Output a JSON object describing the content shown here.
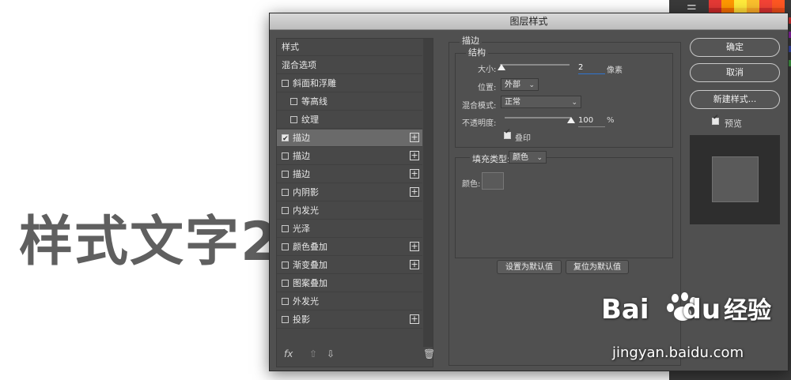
{
  "canvas_text": "样式文字2",
  "dialog": {
    "title": "图层样式",
    "style_list": [
      {
        "label": "样式",
        "checkbox": false,
        "checked": false,
        "plus": false,
        "indent": 0,
        "selected": false
      },
      {
        "label": "混合选项",
        "checkbox": false,
        "checked": false,
        "plus": false,
        "indent": 0,
        "selected": false
      },
      {
        "label": "斜面和浮雕",
        "checkbox": true,
        "checked": false,
        "plus": false,
        "indent": 0,
        "selected": false
      },
      {
        "label": "等高线",
        "checkbox": true,
        "checked": false,
        "plus": false,
        "indent": 1,
        "selected": false
      },
      {
        "label": "纹理",
        "checkbox": true,
        "checked": false,
        "plus": false,
        "indent": 1,
        "selected": false
      },
      {
        "label": "描边",
        "checkbox": true,
        "checked": true,
        "plus": true,
        "indent": 0,
        "selected": true
      },
      {
        "label": "描边",
        "checkbox": true,
        "checked": false,
        "plus": true,
        "indent": 0,
        "selected": false
      },
      {
        "label": "描边",
        "checkbox": true,
        "checked": false,
        "plus": true,
        "indent": 0,
        "selected": false
      },
      {
        "label": "内阴影",
        "checkbox": true,
        "checked": false,
        "plus": true,
        "indent": 0,
        "selected": false
      },
      {
        "label": "内发光",
        "checkbox": true,
        "checked": false,
        "plus": false,
        "indent": 0,
        "selected": false
      },
      {
        "label": "光泽",
        "checkbox": true,
        "checked": false,
        "plus": false,
        "indent": 0,
        "selected": false
      },
      {
        "label": "颜色叠加",
        "checkbox": true,
        "checked": false,
        "plus": true,
        "indent": 0,
        "selected": false
      },
      {
        "label": "渐变叠加",
        "checkbox": true,
        "checked": false,
        "plus": true,
        "indent": 0,
        "selected": false
      },
      {
        "label": "图案叠加",
        "checkbox": true,
        "checked": false,
        "plus": false,
        "indent": 0,
        "selected": false
      },
      {
        "label": "外发光",
        "checkbox": true,
        "checked": false,
        "plus": false,
        "indent": 0,
        "selected": false
      },
      {
        "label": "投影",
        "checkbox": true,
        "checked": false,
        "plus": true,
        "indent": 0,
        "selected": false
      }
    ],
    "bottom_icons": {
      "fx": "fx",
      "up": "arrow-up-icon",
      "down": "arrow-down-icon",
      "trash": "trash-icon"
    },
    "stroke": {
      "section_title": "描边",
      "structure_title": "结构",
      "size_label": "大小:",
      "size_value": "2",
      "size_unit": "像素",
      "size_slider_fraction": 0.02,
      "position_label": "位置:",
      "position_value": "外部",
      "blend_mode_label": "混合模式:",
      "blend_mode_value": "正常",
      "opacity_label": "不透明度:",
      "opacity_value": "100",
      "opacity_unit": "%",
      "opacity_slider_fraction": 1.0,
      "overprint_label": "叠印",
      "overprint_checked": true,
      "fill_type_label": "填充类型:",
      "fill_type_value": "颜色",
      "color_label": "颜色:",
      "color_value": "#5a5a5a",
      "make_default": "设置为默认值",
      "reset_default": "复位为默认值"
    },
    "buttons": {
      "ok": "确定",
      "cancel": "取消",
      "new_style": "新建样式..."
    },
    "preview": {
      "label": "预览",
      "checked": true
    }
  },
  "watermark": {
    "brand": "Bai",
    "brand_suffix": "du",
    "product": "经验",
    "url": "jingyan.baidu.com"
  },
  "colors": {
    "dialog_bg": "#505050",
    "selected_row": "#6a6a6a",
    "accent_blue": "#2f74d0"
  }
}
